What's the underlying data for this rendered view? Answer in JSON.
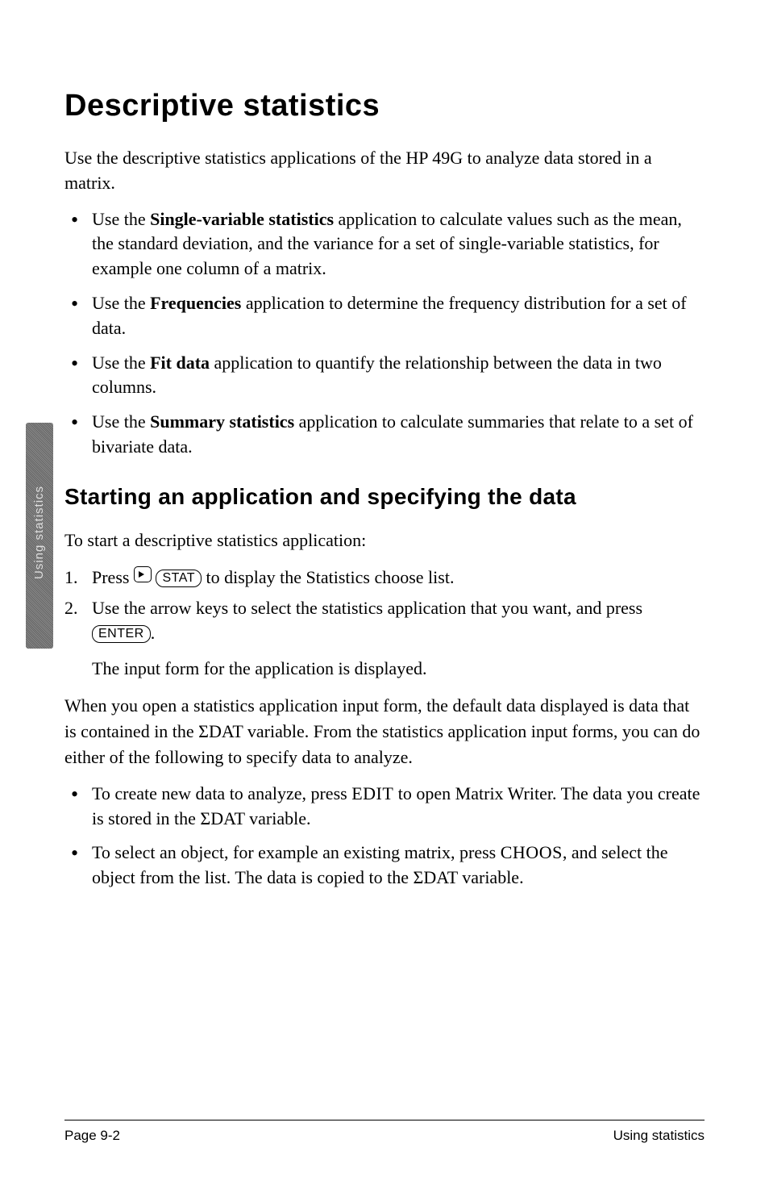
{
  "title": "Descriptive statistics",
  "intro": "Use the descriptive statistics applications of the HP 49G to analyze data stored in a matrix.",
  "bullets1": [
    {
      "bold": "Single-variable statistics",
      "before": "Use the ",
      "after": " application to calculate values such as the mean, the standard deviation, and the variance for a set of single-variable statistics, for example one column of a matrix."
    },
    {
      "bold": "Frequencies",
      "before": "Use the ",
      "after": " application to determine the frequency distribution for a set of data."
    },
    {
      "bold": "Fit data",
      "before": "Use the ",
      "after": " application to quantify the relationship between the data in two columns."
    },
    {
      "bold": "Summary statistics",
      "before": "Use the ",
      "after": " application to calculate summaries that relate to a set of bivariate data."
    }
  ],
  "heading2": "Starting an application and specifying the data",
  "para1": "To start a descriptive statistics application:",
  "steps": [
    {
      "pre": "Press ",
      "key1": "shift",
      "key2": "STAT",
      "post": " to display the Statistics choose list."
    },
    {
      "pre": "Use the arrow keys to select the statistics application that you want, and press ",
      "key1": "ENTER",
      "post": "."
    }
  ],
  "substep": "The input form for the application is displayed.",
  "para2": "When you open a statistics application input form, the default data displayed is data that is contained in the ΣDAT variable. From the statistics application input forms, you can do either of the following to specify data to analyze.",
  "bullets2": [
    {
      "pre": "To create new data to analyze, press ",
      "sc": "EDIT",
      "post": " to open Matrix Writer. The data you create is stored in the ΣDAT variable."
    },
    {
      "pre": "To select an object, for example an existing matrix, press ",
      "sc": "CHOOS",
      "post": ", and select the object from the list. The data is copied to the ΣDAT variable."
    }
  ],
  "sideTab": "Using statistics",
  "footer": {
    "left": "Page 9-2",
    "right": "Using statistics"
  }
}
